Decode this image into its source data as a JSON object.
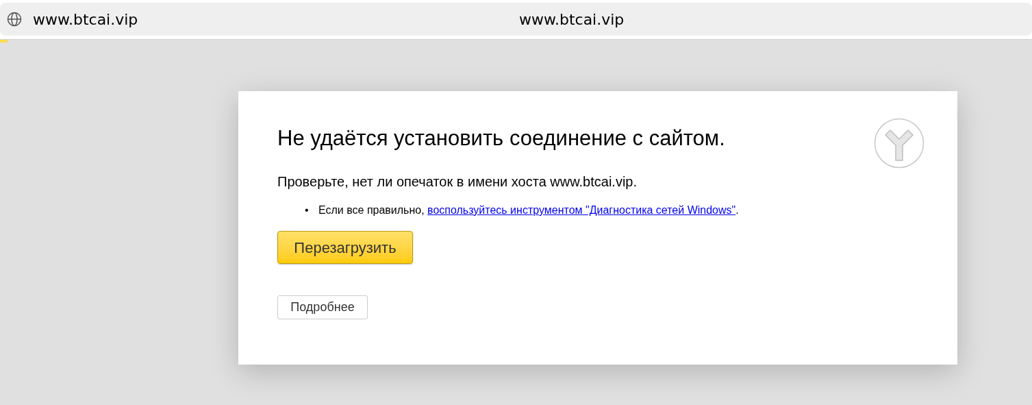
{
  "address_bar": {
    "url": "www.btcai.vip",
    "title": "www.btcai.vip"
  },
  "loading_bar": {
    "level": 0.007
  },
  "error_card": {
    "title": "Не удаётся установить соединение с сайтом.",
    "message": "Проверьте, нет ли опечаток в имени хоста www.btcai.vip.",
    "suggestions": [
      {
        "bullet": "•",
        "text_before": "Если все правильно, ",
        "link": "воспользуйтесь инструментом \"Диагностика сетей Windows\"",
        "text_after": "."
      }
    ],
    "reload_button": "Перезагрузить",
    "details_button": "Подробнее"
  }
}
